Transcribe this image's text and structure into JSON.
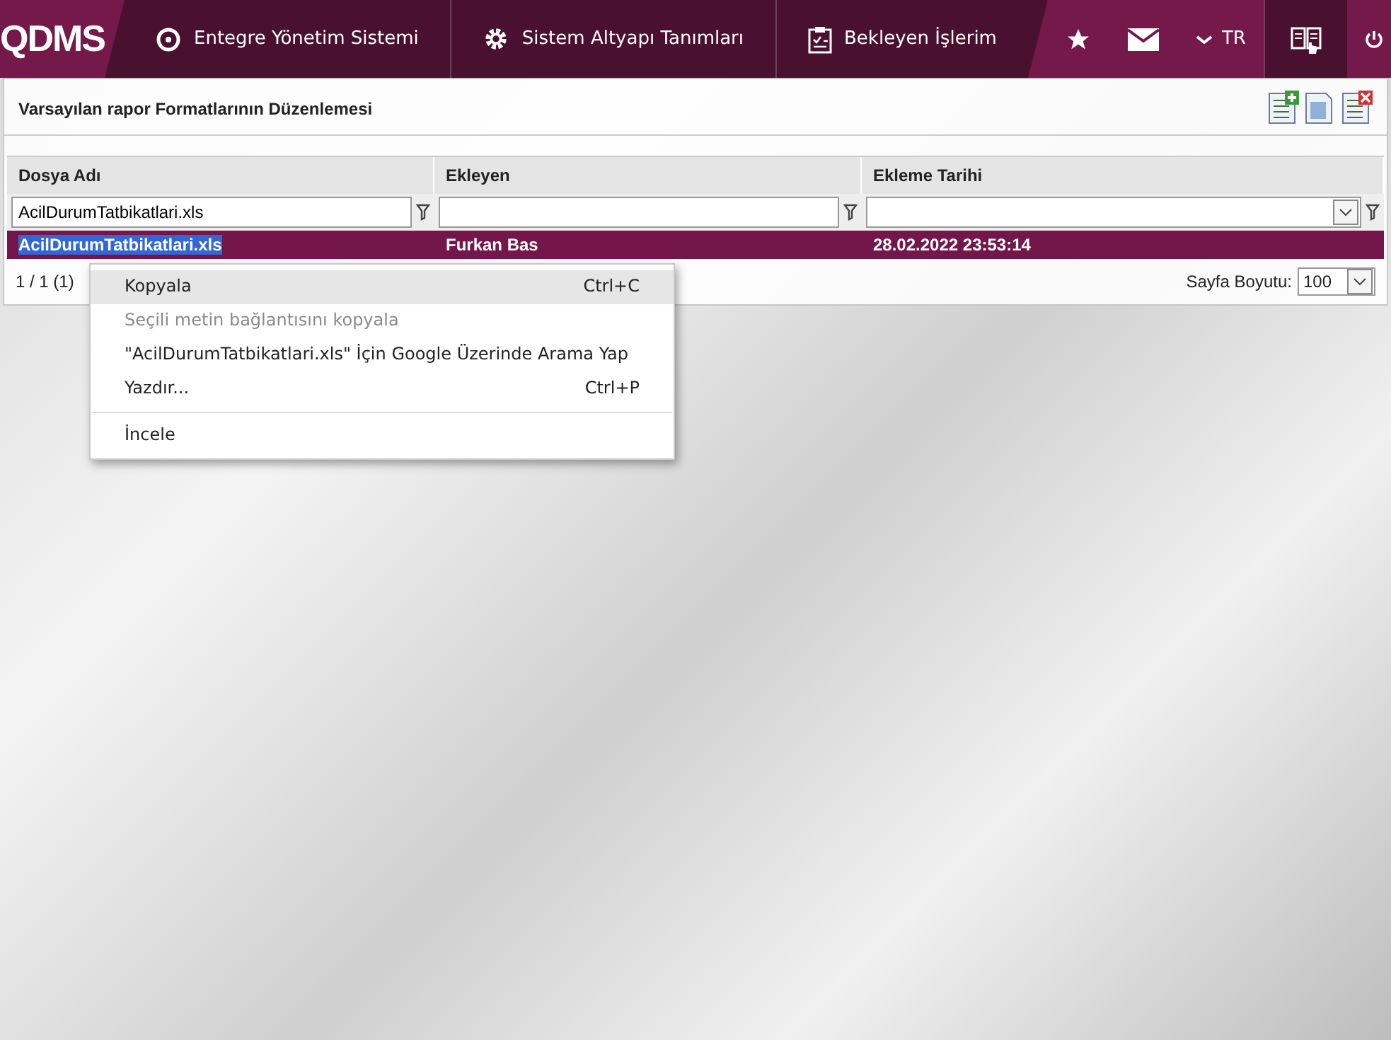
{
  "topbar": {
    "logo": "QDMS",
    "nav": [
      {
        "kind": "q",
        "label": "Entegre Yönetim Sistemi"
      },
      {
        "kind": "gear",
        "label": "Sistem Altyapı Tanımları"
      },
      {
        "kind": "clipboard",
        "label": "Bekleyen İşlerim"
      }
    ],
    "language": "TR"
  },
  "panel": {
    "title": "Varsayılan rapor Formatlarının Düzenlemesi"
  },
  "table": {
    "columns": [
      {
        "label": "Dosya Adı",
        "kind": "text",
        "filter_value": "AcilDurumTatbikatlari.xls"
      },
      {
        "label": "Ekleyen",
        "kind": "text"
      },
      {
        "label": "Ekleme Tarihi",
        "kind": "select"
      }
    ],
    "rows": [
      {
        "selected": true,
        "text_selected": true,
        "cells": [
          "AcilDurumTatbikatlari.xls",
          "Furkan Bas",
          "28.02.2022 23:53:14"
        ]
      }
    ]
  },
  "pager": {
    "summary": "1 / 1 (1)",
    "page_size_label": "Sayfa Boyutu:",
    "page_size": "100"
  },
  "context_menu": [
    {
      "kind": "item",
      "label": "Kopyala",
      "shortcut": "Ctrl+C",
      "disabled": false,
      "selected": true
    },
    {
      "kind": "item",
      "label": "Seçili metin bağlantısını kopyala",
      "disabled": true,
      "selected": false
    },
    {
      "kind": "item",
      "label": "\"AcilDurumTatbikatlari.xls\" İçin Google Üzerinde Arama Yap",
      "disabled": false,
      "selected": false
    },
    {
      "kind": "item",
      "label": "Yazdır...",
      "shortcut": "Ctrl+P",
      "disabled": false,
      "selected": false
    },
    {
      "kind": "separator"
    },
    {
      "kind": "item",
      "label": "İncele",
      "disabled": false,
      "selected": false
    }
  ]
}
